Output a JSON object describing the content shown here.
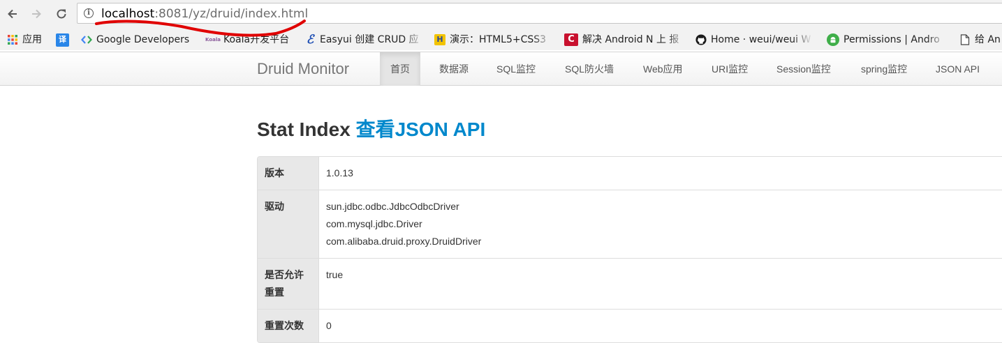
{
  "browser": {
    "url_host": "localhost",
    "url_rest": ":8081/yz/druid/index.html",
    "colors": {
      "annotation": "#e00000"
    },
    "bookmarks": [
      {
        "label": "应用",
        "icon": "apps-grid-icon"
      },
      {
        "label": "译",
        "icon": "translate-icon",
        "color": "#2a86e8"
      },
      {
        "label": "Google Developers",
        "icon": "google-developers-icon"
      },
      {
        "label": "Koala开发平台",
        "icon": "koala-icon"
      },
      {
        "label": "Easyui 创建 CRUD 应",
        "icon": "easyui-icon"
      },
      {
        "label": "演示：HTML5+CSS3",
        "icon": "html5-demo-icon"
      },
      {
        "label": "解决 Android N 上 报",
        "icon": "csdn-icon"
      },
      {
        "label": "Home · weui/weui W",
        "icon": "github-icon"
      },
      {
        "label": "Permissions | Andro",
        "icon": "android-icon"
      },
      {
        "label": "给 An",
        "icon": "document-icon"
      }
    ]
  },
  "navbar": {
    "brand": "Druid Monitor",
    "items": [
      {
        "label": "首页",
        "active": true
      },
      {
        "label": "数据源",
        "active": false
      },
      {
        "label": "SQL监控",
        "active": false
      },
      {
        "label": "SQL防火墙",
        "active": false
      },
      {
        "label": "Web应用",
        "active": false
      },
      {
        "label": "URI监控",
        "active": false
      },
      {
        "label": "Session监控",
        "active": false
      },
      {
        "label": "spring监控",
        "active": false
      },
      {
        "label": "JSON API",
        "active": false
      }
    ]
  },
  "main": {
    "title": "Stat Index",
    "title_link": "查看JSON API",
    "colors": {
      "link": "#0088cc",
      "label_bg": "#e8e8e8"
    },
    "rows": [
      {
        "label": "版本",
        "values": [
          "1.0.13"
        ]
      },
      {
        "label": "驱动",
        "values": [
          "sun.jdbc.odbc.JdbcOdbcDriver",
          "com.mysql.jdbc.Driver",
          "com.alibaba.druid.proxy.DruidDriver"
        ]
      },
      {
        "label": "是否允许重置",
        "values": [
          "true"
        ]
      },
      {
        "label": "重置次数",
        "values": [
          "0"
        ]
      }
    ]
  }
}
